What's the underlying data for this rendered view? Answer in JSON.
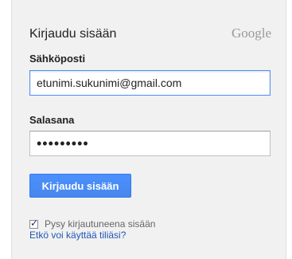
{
  "login": {
    "title": "Kirjaudu sisään",
    "brand": "Google",
    "email_label": "Sähköposti",
    "email_value": "etunimi.sukunimi@gmail.com",
    "password_label": "Salasana",
    "password_value": "•••••••••",
    "submit_label": "Kirjaudu sisään",
    "remember_label": "Pysy kirjautuneena sisään",
    "remember_checked": true,
    "help_link": "Etkö voi käyttää tiliäsi?"
  },
  "colors": {
    "accent": "#4d90fe",
    "link": "#1f56b8",
    "background": "#f1f1f1"
  },
  "icons": {
    "checkbox_check": "check-icon"
  }
}
